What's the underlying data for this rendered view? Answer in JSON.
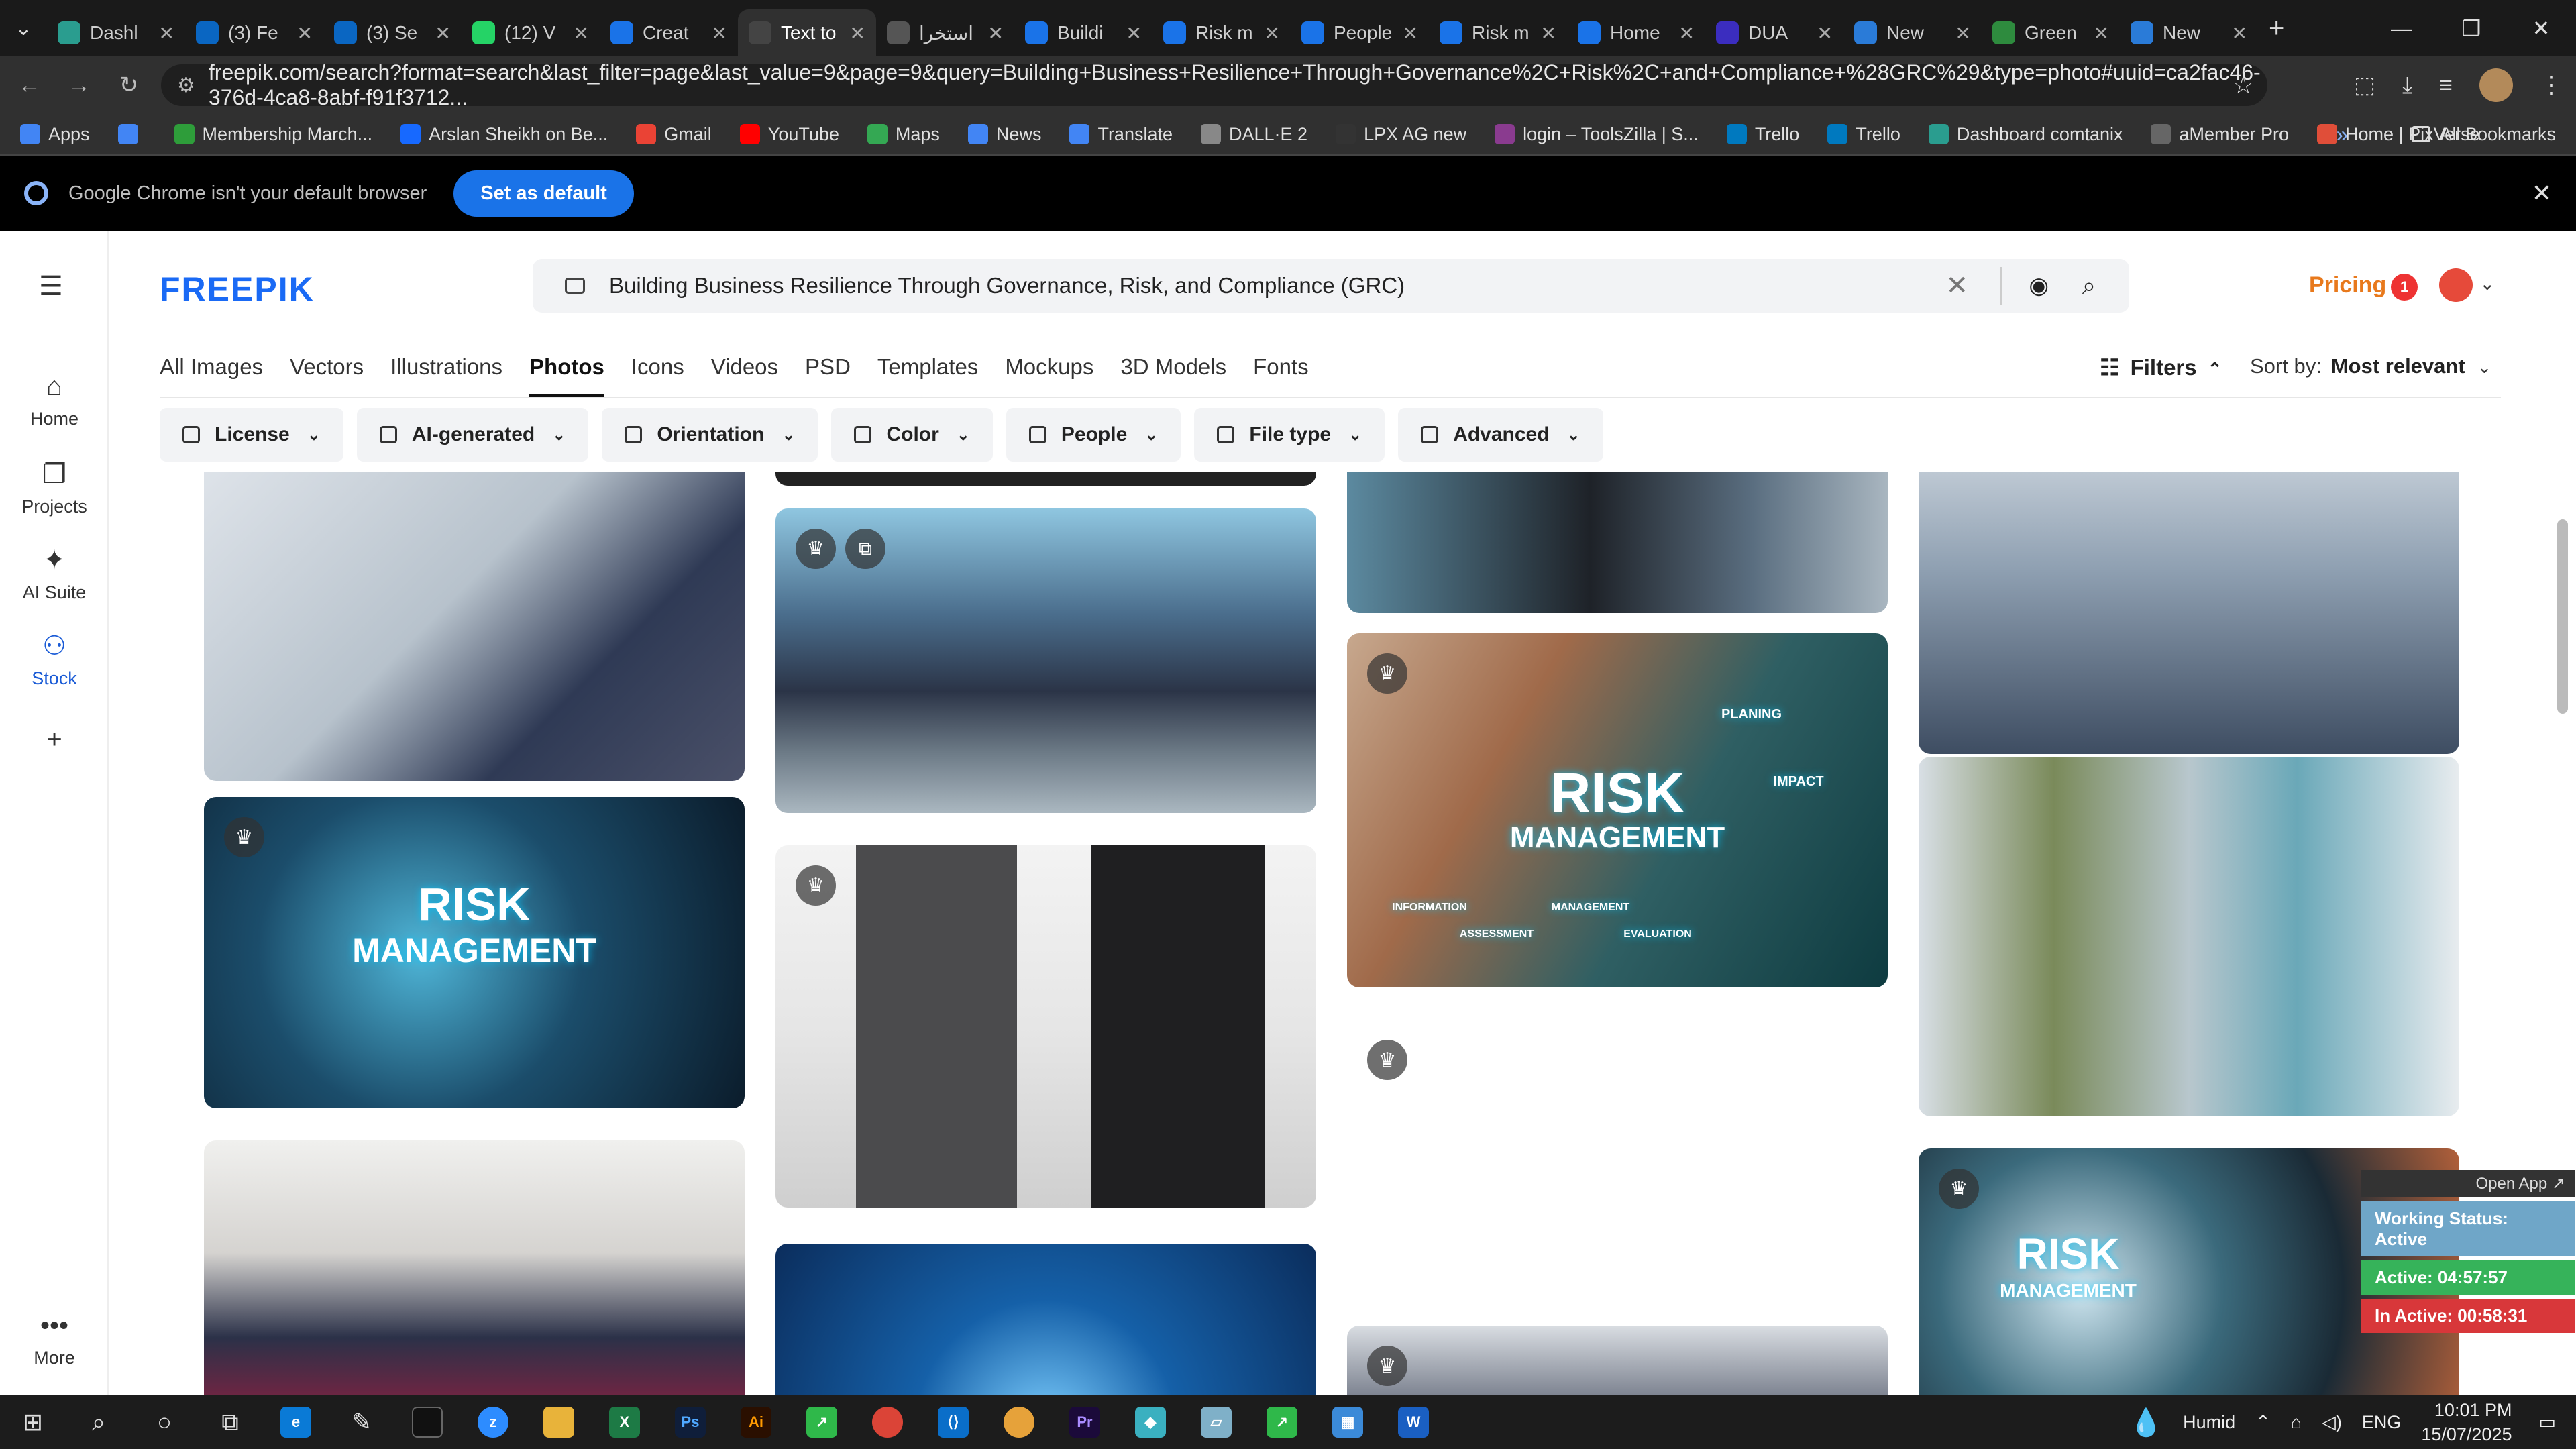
{
  "browser": {
    "tabs": [
      {
        "label": "Dashl",
        "color": "#2a9d8f"
      },
      {
        "label": "(3) Fe",
        "color": "#0a66c2"
      },
      {
        "label": "(3) Se",
        "color": "#0a66c2"
      },
      {
        "label": "(12) V",
        "color": "#25d366"
      },
      {
        "label": "Creat",
        "color": "#1a73e8"
      },
      {
        "label": "Text to",
        "color": "#444444",
        "active": true
      },
      {
        "label": "استخرا",
        "color": "#555555"
      },
      {
        "label": "Buildi",
        "color": "#1a73e8"
      },
      {
        "label": "Risk m",
        "color": "#1a73e8"
      },
      {
        "label": "People",
        "color": "#1a73e8"
      },
      {
        "label": "Risk m",
        "color": "#1a73e8"
      },
      {
        "label": "Home",
        "color": "#1a73e8"
      },
      {
        "label": "DUA",
        "color": "#3b2dbf"
      },
      {
        "label": "New",
        "color": "#2a7bd8"
      },
      {
        "label": "Green",
        "color": "#2e8b3e"
      },
      {
        "label": "New",
        "color": "#2a7bd8"
      }
    ],
    "url": "freepik.com/search?format=search&last_filter=page&last_value=9&page=9&query=Building+Business+Resilience+Through+Governance%2C+Risk%2C+and+Compliance+%28GRC%29&type=photo#uuid=ca2fac46-376d-4ca8-8abf-f91f3712...",
    "bookmarks": [
      {
        "label": "Apps",
        "color": "#4285f4"
      },
      {
        "label": "",
        "color": "#4285f4"
      },
      {
        "label": "Membership March...",
        "color": "#2e9d3a"
      },
      {
        "label": "Arslan Sheikh on Be...",
        "color": "#1769ff"
      },
      {
        "label": "Gmail",
        "color": "#ea4335"
      },
      {
        "label": "YouTube",
        "color": "#ff0000"
      },
      {
        "label": "Maps",
        "color": "#34a853"
      },
      {
        "label": "News",
        "color": "#4285f4"
      },
      {
        "label": "Translate",
        "color": "#4285f4"
      },
      {
        "label": "DALL·E 2",
        "color": "#888888"
      },
      {
        "label": "LPX AG new",
        "color": "#333333"
      },
      {
        "label": "login – ToolsZilla | S...",
        "color": "#8a3b8f"
      },
      {
        "label": "Trello",
        "color": "#0079bf"
      },
      {
        "label": "Trello",
        "color": "#0079bf"
      },
      {
        "label": "Dashboard comtanix",
        "color": "#2a9d8f"
      },
      {
        "label": "aMember Pro",
        "color": "#666666"
      },
      {
        "label": "Home | PixVerse",
        "color": "#e04e39"
      }
    ],
    "all_bookmarks": "All Bookmarks",
    "infobar": {
      "message": "Google Chrome isn't your default browser",
      "button": "Set as default"
    }
  },
  "site": {
    "logo": "FREEPIK",
    "search_query": "Building Business Resilience Through Governance, Risk, and Compliance (GRC)",
    "pricing": "Pricing",
    "notification_count": "1",
    "rail": [
      {
        "label": "Home",
        "icon": "home-icon",
        "glyph": "⌂"
      },
      {
        "label": "Projects",
        "icon": "projects-icon",
        "glyph": "❐"
      },
      {
        "label": "AI Suite",
        "icon": "ai-suite-icon",
        "glyph": "✦"
      },
      {
        "label": "Stock",
        "icon": "stock-icon",
        "glyph": "⚇",
        "active": true
      },
      {
        "label": "",
        "icon": "add-icon",
        "glyph": "+"
      },
      {
        "label": "More",
        "icon": "more-icon",
        "glyph": "•••"
      }
    ],
    "categories": [
      "All Images",
      "Vectors",
      "Illustrations",
      "Photos",
      "Icons",
      "Videos",
      "PSD",
      "Templates",
      "Mockups",
      "3D Models",
      "Fonts"
    ],
    "active_category": "Photos",
    "filters_label": "Filters",
    "sort_label": "Sort by:",
    "sort_value": "Most relevant",
    "chips": [
      "License",
      "AI-generated",
      "Orientation",
      "Color",
      "People",
      "File type",
      "Advanced"
    ]
  },
  "results": {
    "texts": {
      "risk1": "RISK",
      "mgmt1": "MANAGEMENT",
      "risk2": "RISK",
      "mgmt2": "MANAGEMENT",
      "planing": "PLANING",
      "impact": "IMPACT",
      "information": "INFORMATION",
      "assessment": "ASSESSMENT",
      "management": "MANAGEMENT",
      "evaluation": "EVALUATION",
      "risk3": "RISK",
      "mgmt3": "MANAGEMENT"
    }
  },
  "widget": {
    "open_app": "Open App ↗",
    "working_status": "Working Status: Active",
    "active": "Active: 04:57:57",
    "inactive": "In Active: 00:58:31"
  },
  "taskbar": {
    "weather": "Humid",
    "lang": "ENG",
    "time": "10:01 PM",
    "date": "15/07/2025"
  }
}
